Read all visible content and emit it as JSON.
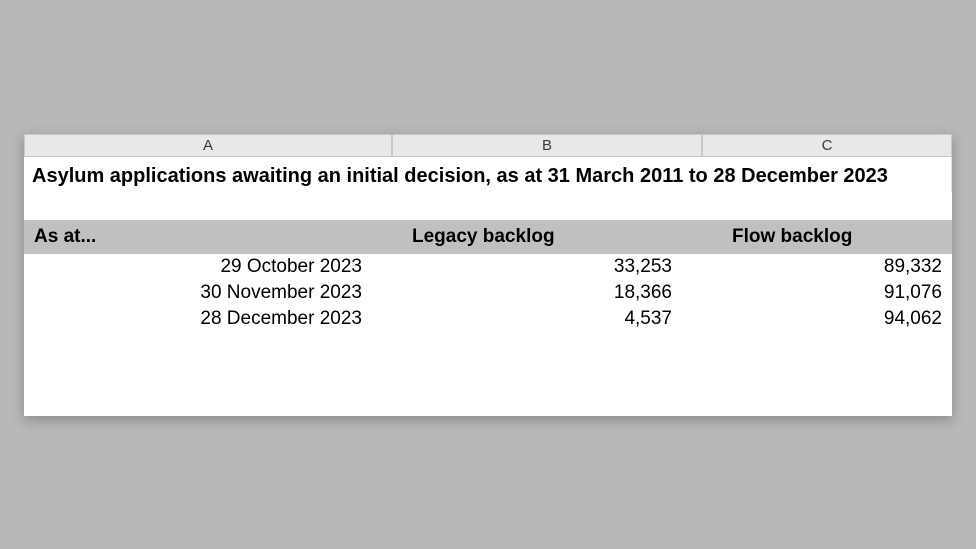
{
  "columns": {
    "a": "A",
    "b": "B",
    "c": "C"
  },
  "title": "Asylum applications awaiting an initial decision, as at 31 March 2011 to 28 December 2023",
  "subheaders": {
    "a": "As at...",
    "b": "Legacy backlog",
    "c": "Flow backlog"
  },
  "rows": [
    {
      "date": "29 October 2023",
      "legacy": "33,253",
      "flow": "89,332"
    },
    {
      "date": "30 November 2023",
      "legacy": "18,366",
      "flow": "91,076"
    },
    {
      "date": "28 December 2023",
      "legacy": "4,537",
      "flow": "94,062"
    }
  ],
  "chart_data": {
    "type": "table",
    "title": "Asylum applications awaiting an initial decision, as at 31 March 2011 to 28 December 2023",
    "categories": [
      "29 October 2023",
      "30 November 2023",
      "28 December 2023"
    ],
    "series": [
      {
        "name": "Legacy backlog",
        "values": [
          33253,
          18366,
          4537
        ]
      },
      {
        "name": "Flow backlog",
        "values": [
          89332,
          91076,
          94062
        ]
      }
    ]
  }
}
